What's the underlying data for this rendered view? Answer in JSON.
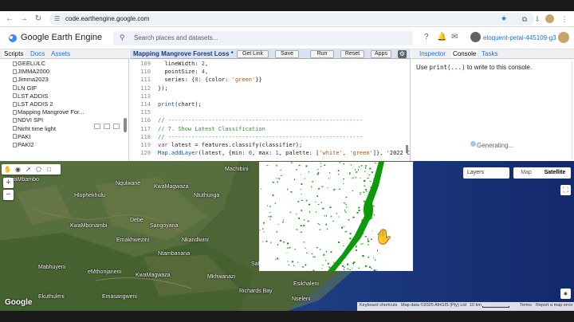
{
  "browser": {
    "url": "code.earthengine.google.com",
    "back_icon": "arrow-left",
    "forward_icon": "arrow-right",
    "reload_icon": "reload"
  },
  "header": {
    "app_title": "Google Earth Engine",
    "search_placeholder": "Search places and datasets...",
    "project": "eloquent-petal-445109-g3"
  },
  "left_panel": {
    "tabs": [
      "Scripts",
      "Docs",
      "Assets"
    ],
    "scripts": [
      "GEELULC",
      "JIMMA2000",
      "Jimma2023",
      "LN GIF",
      "LST ADDIS",
      "LST ADDIS 2",
      "Mapping Mangrove For...",
      "NDVI SPI",
      "Nirht time light",
      "PAKI",
      "PAKI2"
    ]
  },
  "editor": {
    "filename": "Mapping Mangrove Forest Loss *",
    "buttons": [
      "Get Link",
      "Save",
      "Run",
      "Reset",
      "Apps"
    ],
    "lines": [
      {
        "n": "109",
        "code": "  lineWidth: 2,"
      },
      {
        "n": "110",
        "code": "  pointSize: 4,"
      },
      {
        "n": "111",
        "code": "  series: {0: {color: 'green'}}"
      },
      {
        "n": "112",
        "code": "});"
      },
      {
        "n": "113",
        "code": ""
      },
      {
        "n": "114",
        "code": "print(chart);"
      },
      {
        "n": "115",
        "code": ""
      },
      {
        "n": "116",
        "code": "// ----------------------------------------------------------"
      },
      {
        "n": "117",
        "code": "// 7. Show Latest Classification"
      },
      {
        "n": "118",
        "code": "// ----------------------------------------------------------"
      },
      {
        "n": "119",
        "code": "var latest = features.classify(classifier);"
      },
      {
        "n": "120",
        "code": "Map.addLayer(latest, {min: 0, max: 1, palette: ['white', 'green']}, '2022 C"
      }
    ]
  },
  "right_panel": {
    "tabs": [
      "Inspector",
      "Console",
      "Tasks"
    ],
    "console_hint_pre": "Use ",
    "console_hint_code": "print(...)",
    "console_hint_post": " to write to this console.",
    "status": "Generating..."
  },
  "map": {
    "labels": [
      "Machibini",
      "Ngqiko",
      "KwaMbambo",
      "Nqulwane",
      "Hlophekhulu",
      "Ntuthunga",
      "KwaMagwaza",
      "Debe",
      "Sangoyana",
      "KwaMbonambi",
      "Emakhwezini",
      "Nkandlwini",
      "eMthonjaneni",
      "Ntambanana",
      "Mabhuyeni",
      "KwaMagwaza",
      "Mkhwanazi",
      "Sabhuza",
      "Esikhaleni",
      "Emasangweni",
      "Ekuthuleni",
      "Richards Bay",
      "Nseleni"
    ],
    "layers_label": "Layers",
    "map_types": [
      "Map",
      "Satellite"
    ],
    "active_map_type": "Satellite",
    "attribution": [
      "Keyboard shortcuts",
      "Map data ©2025 AfriGIS (Pty) Ltd",
      "10 km",
      "Terms",
      "Report a map error"
    ],
    "logo": "Google",
    "overlay_palette": [
      "#ffffff",
      "#0a9a0a"
    ]
  }
}
